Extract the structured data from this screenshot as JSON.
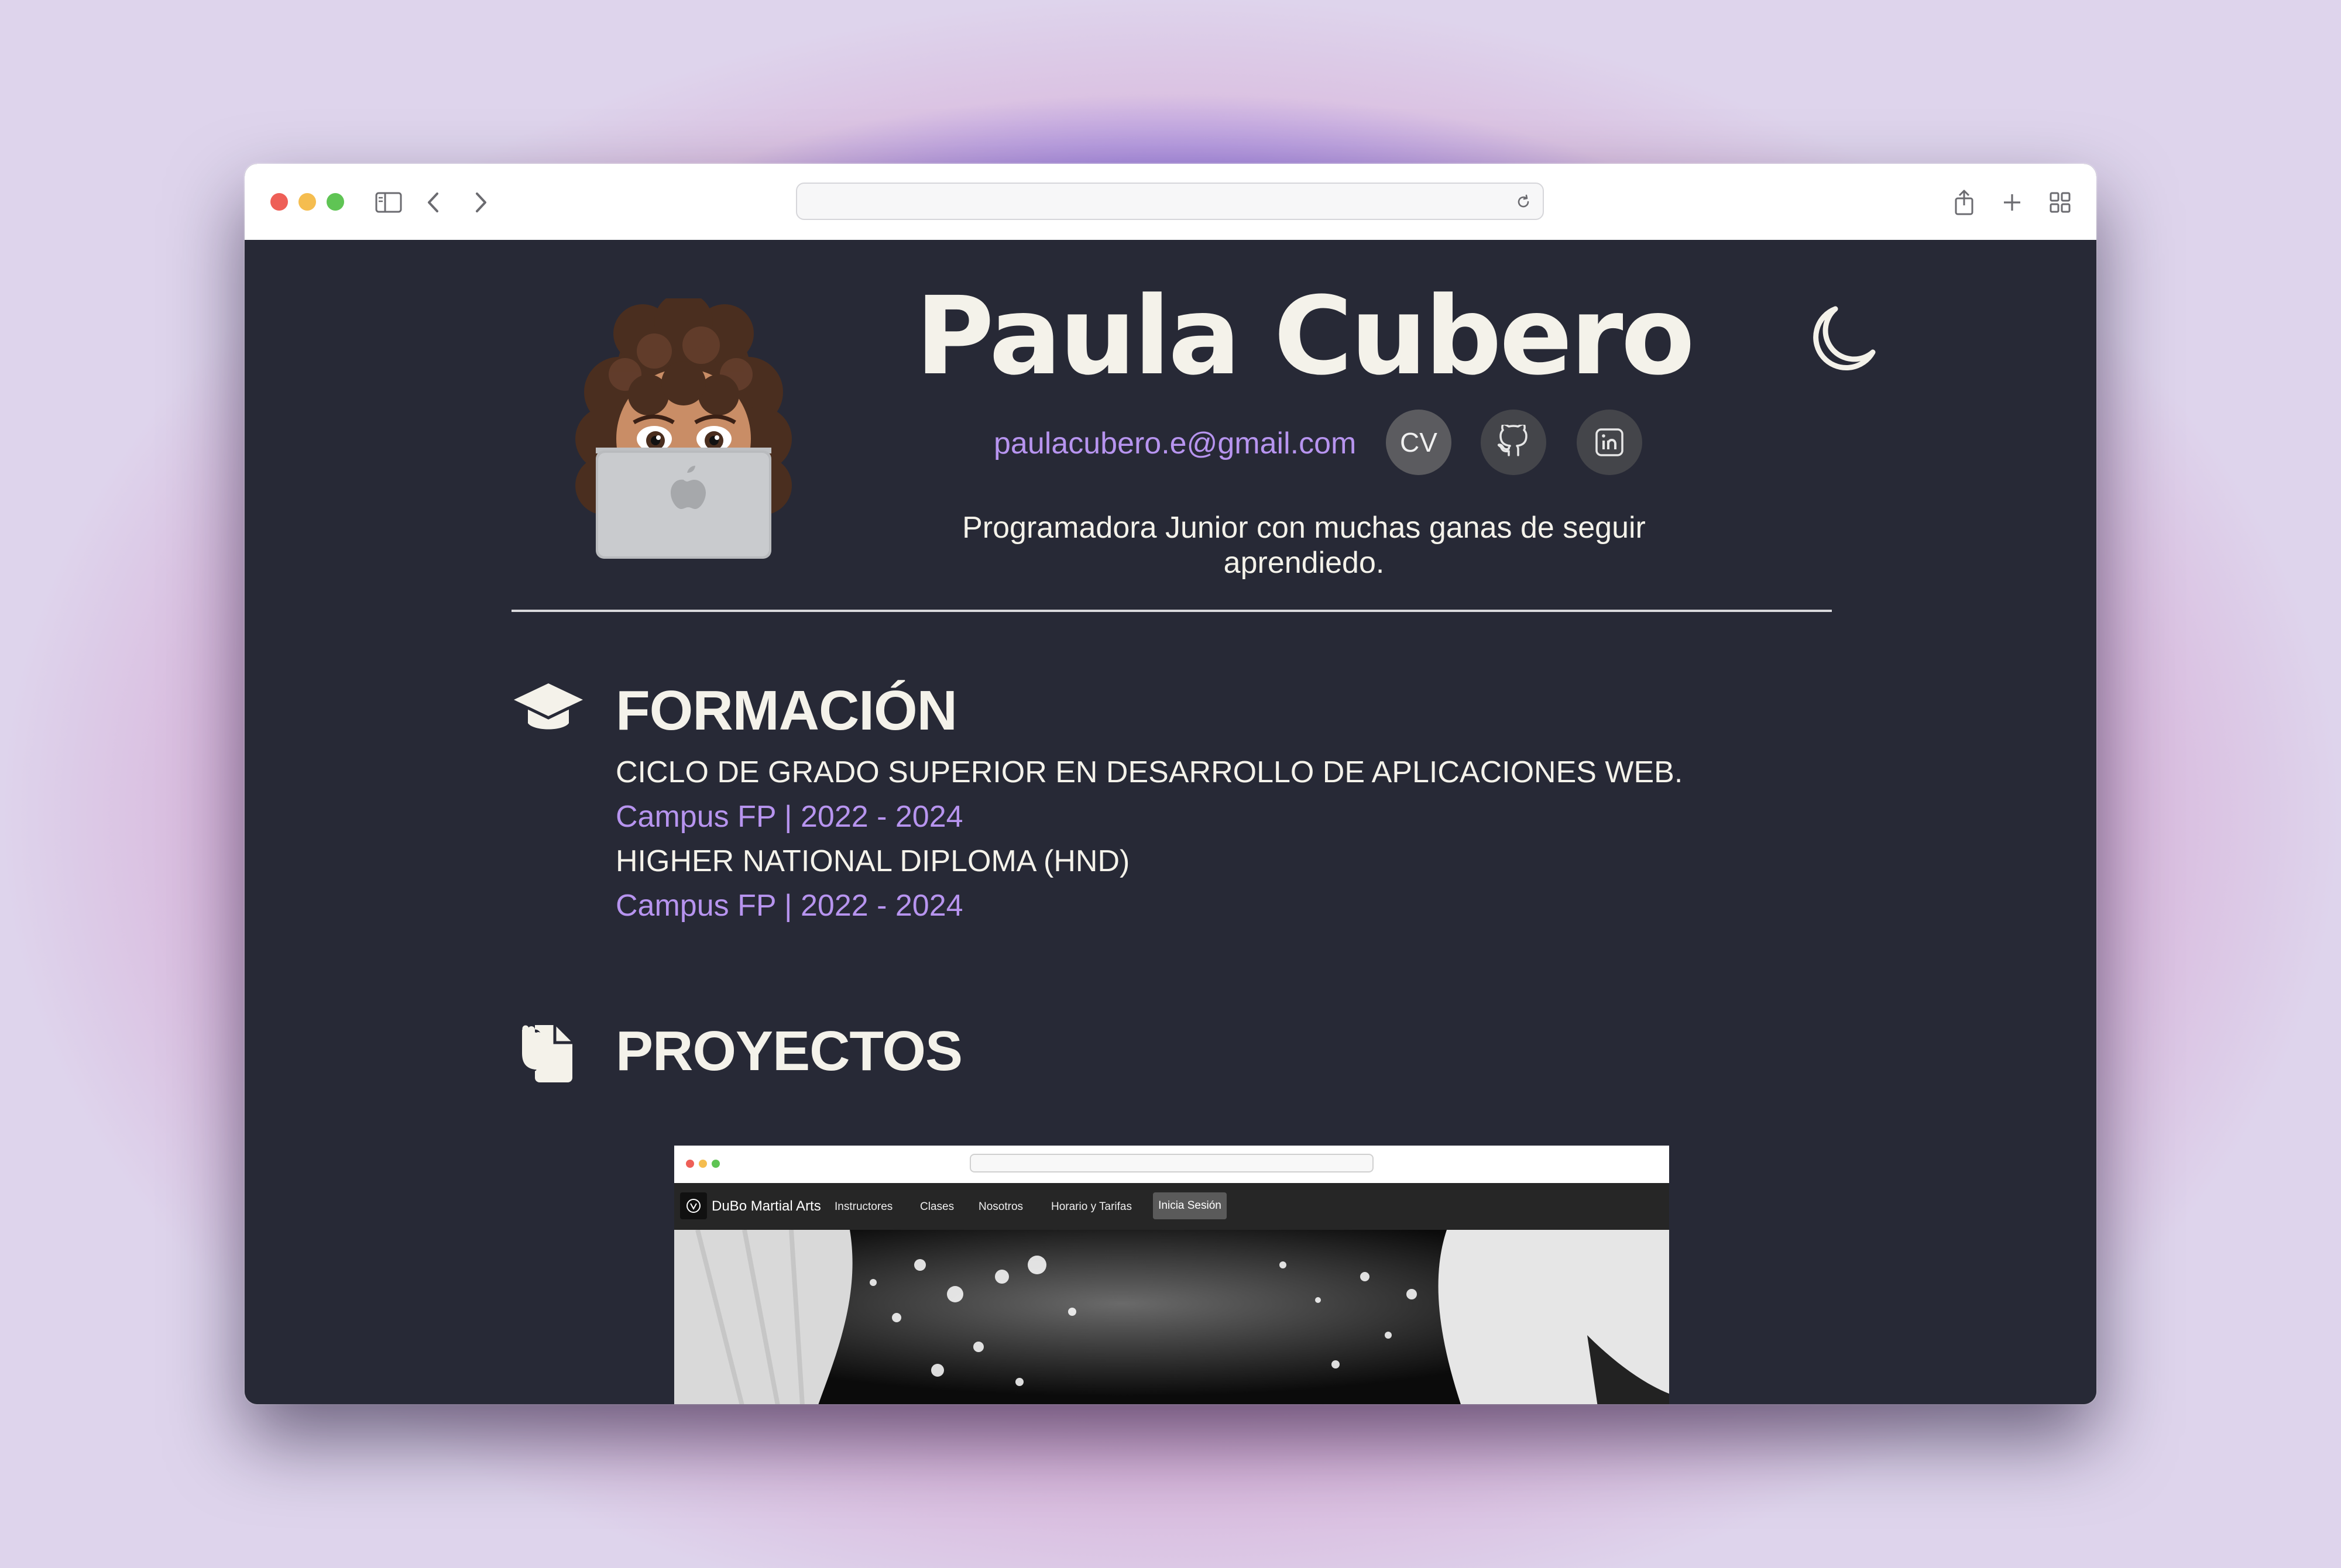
{
  "profile": {
    "name": "Paula Cubero",
    "email": "paulacubero.e@gmail.com",
    "cv_label": "CV",
    "tagline": "Programadora Junior con muchas ganas de seguir aprendiedo."
  },
  "icons": {
    "theme_toggle": "moon-icon",
    "github": "github-icon",
    "linkedin": "linkedin-icon",
    "formacion": "graduation-cap-icon",
    "proyectos": "file-hand-icon"
  },
  "formacion": {
    "title": "FORMACIÓN",
    "items": [
      {
        "title": "CICLO DE GRADO SUPERIOR EN DESARROLLO DE APLICACIONES WEB.",
        "subtitle": "Campus FP | 2022 - 2024"
      },
      {
        "title": "HIGHER NATIONAL DIPLOMA (HND)",
        "subtitle": "Campus FP | 2022 - 2024"
      }
    ]
  },
  "proyectos": {
    "title": "PROYECTOS",
    "preview": {
      "brand": "DuBo Martial Arts",
      "nav": [
        "Instructores",
        "Clases",
        "Nosotros",
        "Horario y Tarifas"
      ],
      "login": "Inicia Sesión"
    }
  },
  "colors": {
    "page_bg": "#272936",
    "accent": "#b794ef",
    "text": "#f4f2ea"
  }
}
